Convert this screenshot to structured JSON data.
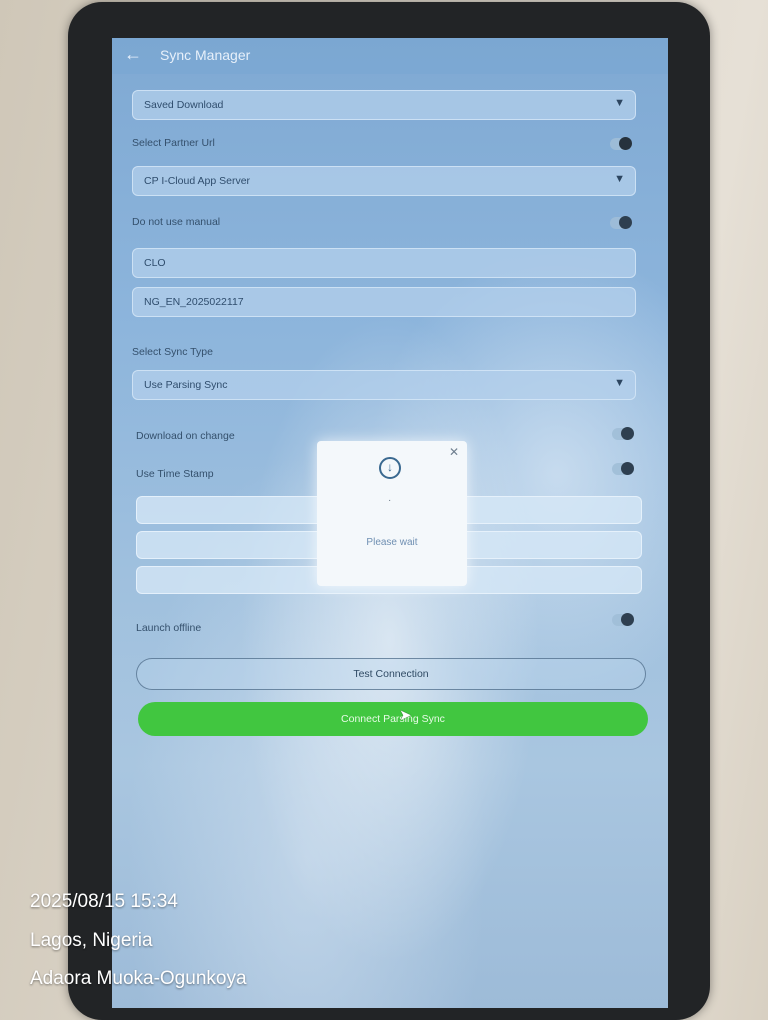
{
  "header": {
    "back_icon": "arrow-left-icon",
    "title": "Sync Manager"
  },
  "form": {
    "download_select": {
      "value": "Saved Download"
    },
    "partner_url_label": "Select Partner Url",
    "partner_url_toggle": true,
    "server_select": {
      "value": "CP I-Cloud App Server"
    },
    "manual_label": "Do not use manual",
    "manual_toggle": false,
    "code_field": {
      "value": "CLO"
    },
    "id_field": {
      "value": "NG_EN_2025022117"
    },
    "sync_type_label": "Select Sync Type",
    "sync_type_select": {
      "value": "Use Parsing Sync"
    },
    "download_on_change_label": "Download on change",
    "download_on_change_toggle": false,
    "time_stamp_label": "Use Time Stamp",
    "time_stamp_toggle": false,
    "launch_offline_label": "Launch offline",
    "launch_offline_toggle": false
  },
  "buttons": {
    "test_connection": "Test Connection",
    "connect_sync": "Connect Parsing Sync"
  },
  "dialog": {
    "close_icon": "close-icon",
    "icon": "download-icon",
    "dot": "·",
    "message": "Please wait"
  },
  "photo_overlay": {
    "timestamp": "2025/08/15 15:34",
    "location": "Lagos, Nigeria",
    "author": "Adaora Muoka-Ogunkoya"
  },
  "colors": {
    "primary_button": "#41c640",
    "screen_tint": "#8db5dc"
  }
}
